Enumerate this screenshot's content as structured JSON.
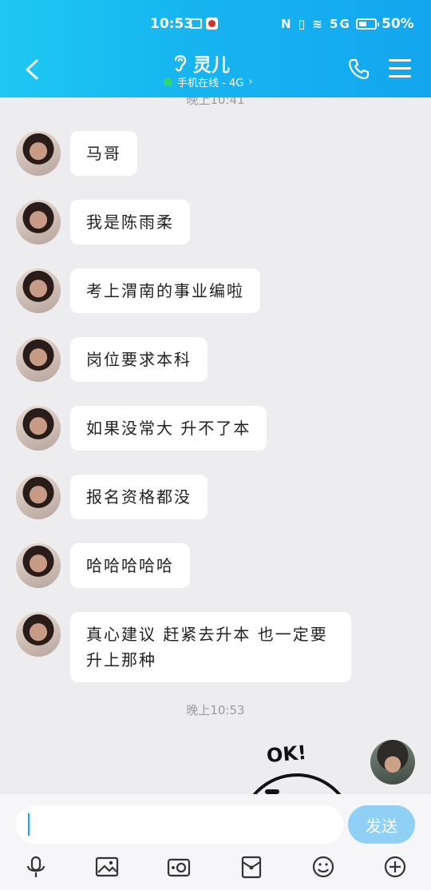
{
  "status_bar": {
    "time": "10:53",
    "signal_icons": "N ▯ ≋ 5G",
    "battery_percent": "50%",
    "battery_level": 0.5
  },
  "header": {
    "contact_name": "灵儿",
    "contact_status": "手机在线 - 4G",
    "status_chevron": "›"
  },
  "chat": {
    "timestamp_top": "晚上10:41",
    "timestamp_mid": "晚上10:53",
    "messages": [
      "马哥",
      "我是陈雨柔",
      "考上渭南的事业编啦",
      "岗位要求本科",
      "如果没常大  升不了本",
      "报名资格都没",
      "哈哈哈哈哈",
      "真心建议  赶紧去升本   也一定要升上那种"
    ],
    "sticker_text": "OK!"
  },
  "input": {
    "value": "",
    "send_label": "发送"
  },
  "colors": {
    "header_start": "#1ec8f2",
    "header_end": "#13a6ef",
    "send_button": "#8fd0f4",
    "online": "#2ed573"
  },
  "icons": [
    "back-icon",
    "ear-icon",
    "phone-icon",
    "menu-icon",
    "mic-icon",
    "image-icon",
    "camera-icon",
    "wallet-icon",
    "emoji-icon",
    "plus-icon"
  ]
}
